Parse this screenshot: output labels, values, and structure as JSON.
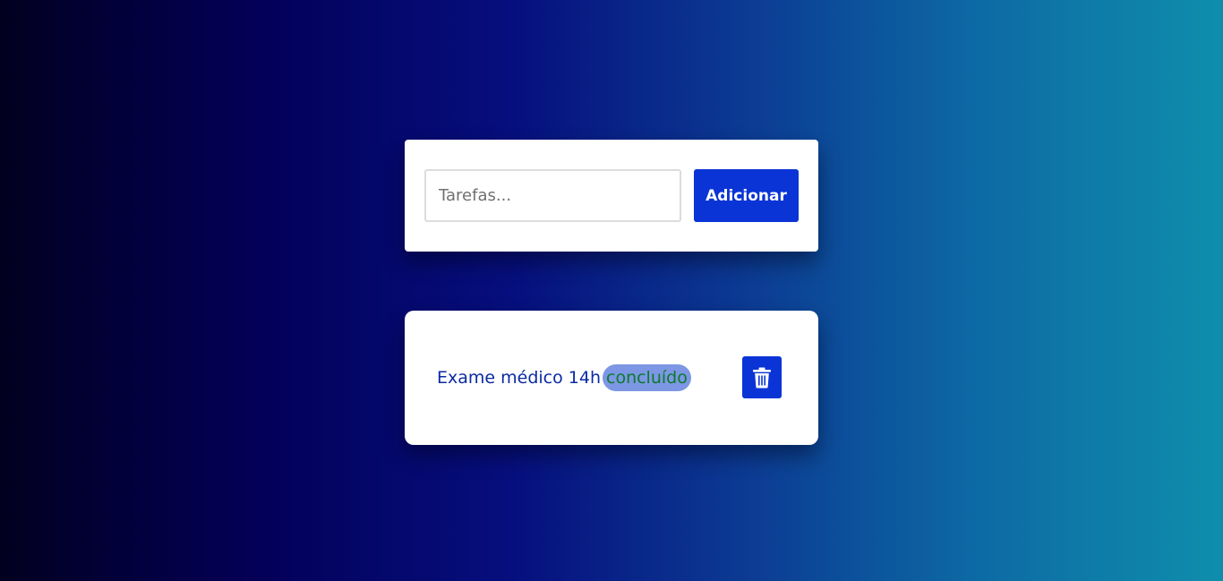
{
  "add_form": {
    "input_placeholder": "Tarefas...",
    "input_value": "",
    "add_label": "Adicionar"
  },
  "tasks": [
    {
      "text": "Exame médico 14h",
      "status": "concluído",
      "delete_icon": "trash-icon"
    }
  ],
  "colors": {
    "accent": "#0a34d6",
    "task_text": "#0b2aa3",
    "status_text": "#0c7a2c",
    "status_background": "#7d97e4"
  }
}
